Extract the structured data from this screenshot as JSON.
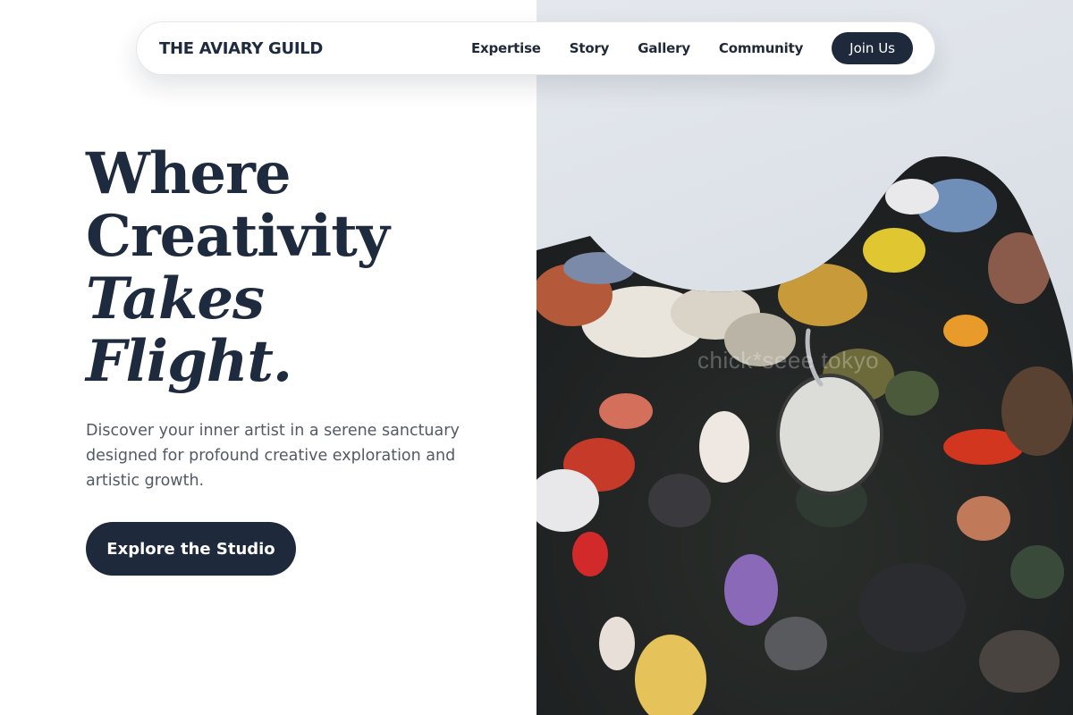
{
  "nav": {
    "brand": "THE AVIARY GUILD",
    "links": [
      "Expertise",
      "Story",
      "Gallery",
      "Community"
    ],
    "cta": "Join Us"
  },
  "hero": {
    "title_lines": [
      "Where",
      "Creativity",
      "Takes",
      "Flight."
    ],
    "description": "Discover your inner artist in a serene sanctuary designed for profound creative exploration and artistic growth.",
    "cta": "Explore the Studio"
  },
  "image": {
    "subject": "artist paint palette with colorful oil paint",
    "watermark": "chick*seee tokyo"
  },
  "colors": {
    "primary": "#1e293b",
    "text": "#1e2a3e",
    "muted": "#525a66",
    "background": "#ffffff"
  }
}
